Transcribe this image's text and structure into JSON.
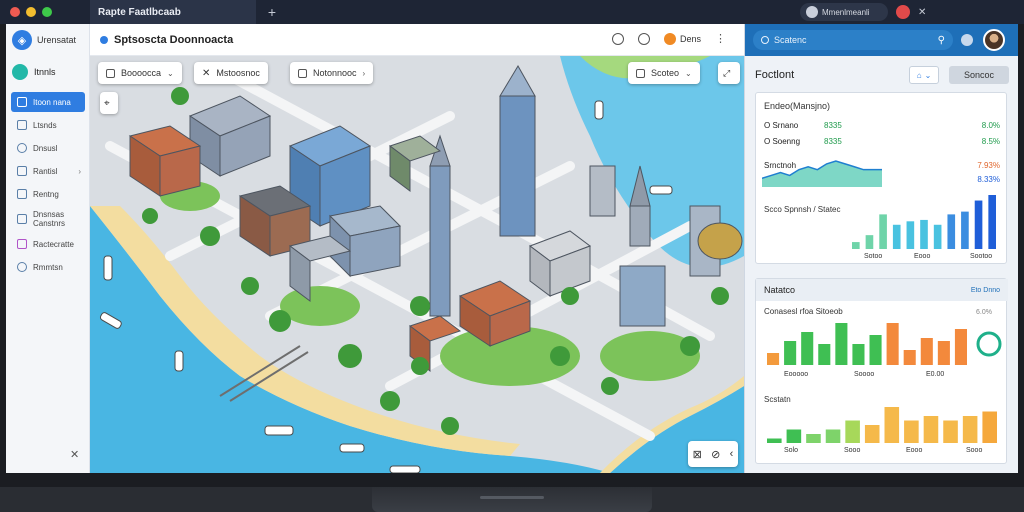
{
  "window": {
    "tab_title": "Rapte Faatlbcaab",
    "tab_new": "+",
    "pill_label": "Mmenlmeanli",
    "close_glyph": "✕"
  },
  "sidebar": {
    "logo_label": "Urensatat",
    "home_label": "Itnnls",
    "items": [
      {
        "label": "Itoon nana",
        "active": true
      },
      {
        "label": "Ltsnds"
      },
      {
        "label": "Dnsusl"
      },
      {
        "label": "Rantisl",
        "chevron": true
      },
      {
        "label": "Rentng"
      },
      {
        "label": "Dnsnsas Canstnrs"
      },
      {
        "label": "Ractecratte"
      },
      {
        "label": "Rmmtsn"
      }
    ],
    "close_glyph": "✕"
  },
  "header": {
    "title": "Sptsoscta Doonnoacta",
    "chip_label": "Dens"
  },
  "map": {
    "controls": [
      {
        "label": "Boooocca",
        "chevron": "⌄"
      },
      {
        "label": "Mstoosnoc"
      },
      {
        "label": "Notonnooc",
        "chevron": "›"
      }
    ],
    "right_control": "Scoteo",
    "right_chevron": "⌄",
    "zoom_glyphs": [
      "⊠",
      "⊘",
      "‹"
    ],
    "colors": {
      "water": "#49b6e3",
      "sand": "#f3dda0",
      "road": "#c3c7cc",
      "park": "#7cc35a"
    }
  },
  "panel": {
    "search_placeholder": "Scatenc",
    "title": "Foctlont",
    "home_button": "⌂",
    "action_button": "Soncoc",
    "card1": {
      "title": "Endeo(Mansjno)",
      "rows": [
        {
          "label": "O Srnano",
          "v1": "8335",
          "v2": "8.0%"
        },
        {
          "label": "O Soenng",
          "v1": "8335",
          "v2": "8.5%"
        },
        {
          "label": "Srnctnoh",
          "v1": "",
          "v2": "7.93%"
        },
        {
          "label": "",
          "v1": "",
          "v2": "8.33%"
        }
      ],
      "sub_label": "Scco Spnnsh / Statec",
      "bar_labels": [
        "Sotoo",
        "Eooo",
        "Sootoo"
      ]
    },
    "card2": {
      "title": "Natatco",
      "badge": "Eto Dnno",
      "chart1_title": "Conasesl rfoa Sitoeob",
      "chart1_value": "6.0%",
      "chart1_labels": [
        "Eooooo",
        "Soooo",
        "E0.00"
      ],
      "chart2_title": "Scstatn",
      "chart2_labels": [
        "Solo",
        "Sooo",
        "Eooo",
        "Sooo"
      ]
    }
  },
  "chart_data": [
    {
      "type": "area",
      "title": "Srnctnoh",
      "values": [
        3,
        4,
        5,
        4,
        6,
        7,
        6,
        8,
        9,
        8,
        7,
        6,
        6,
        6
      ]
    },
    {
      "type": "bar",
      "title": "Scco Spnnsh / Statec",
      "categories": [
        "Sotoo",
        "Eooo",
        "Sootoo"
      ],
      "values": [
        1,
        2,
        5,
        3.5,
        4,
        4.2,
        3.5,
        5,
        5.4,
        7,
        7.8
      ],
      "colors": [
        "#6fd4a9",
        "#6fd4a9",
        "#6fd4a9",
        "#49c2e0",
        "#49c2e0",
        "#49c2e0",
        "#49c2e0",
        "#3b8de0",
        "#3b8de0",
        "#1f5ed8",
        "#1f5ed8"
      ]
    },
    {
      "type": "bar",
      "title": "Conasesl rfoa Sitoeob",
      "values": [
        2,
        4,
        5.5,
        3.5,
        7,
        3.5,
        5,
        7,
        2.5,
        4.5,
        4,
        6
      ],
      "colors": [
        "#f39a3c",
        "#3fbf53",
        "#3fbf53",
        "#3fbf53",
        "#3fbf53",
        "#3fbf53",
        "#3fbf53",
        "#f3893c",
        "#f3893c",
        "#f3893c",
        "#f3893c",
        "#f3893c"
      ]
    },
    {
      "type": "bar",
      "title": "Scstatn",
      "values": [
        1,
        3,
        2,
        3,
        5,
        4,
        8,
        5,
        6,
        5,
        6,
        7
      ],
      "colors": [
        "#3fbf53",
        "#3fbf53",
        "#7ed36a",
        "#7ed36a",
        "#a7d85a",
        "#f5b94a",
        "#f5b94a",
        "#f5b94a",
        "#f5b94a",
        "#f5b94a",
        "#f5b94a",
        "#f5a83c"
      ]
    }
  ]
}
